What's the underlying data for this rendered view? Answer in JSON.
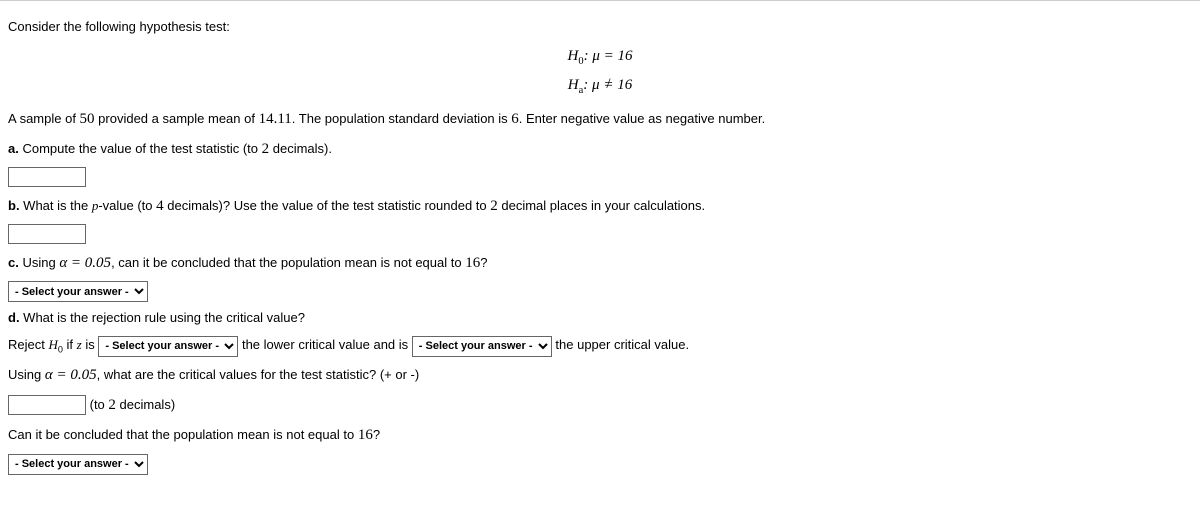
{
  "intro": "Consider the following hypothesis test:",
  "hyp_h0_lhs": "H",
  "hyp_h0_sub": "0",
  "hyp_h0_rest": ": μ = 16",
  "hyp_ha_lhs": "H",
  "hyp_ha_sub": "a",
  "hyp_ha_rest_pre": ": μ ",
  "hyp_ha_rest_post": " 16",
  "neq": "=",
  "sample_pre": "A sample of ",
  "sample_n": "50",
  "sample_mid1": " provided a sample mean of ",
  "sample_mean": "14.11",
  "sample_mid2": ". The population standard deviation is ",
  "sample_sigma": "6",
  "sample_end": ". Enter negative value as negative number.",
  "a_label": "a.",
  "a_text_pre": " Compute the value of the test statistic (to ",
  "a_text_dec": "2",
  "a_text_post": " decimals).",
  "b_label": "b.",
  "b_text_pre": " What is the ",
  "b_pvalue": "p",
  "b_text_mid": "-value (to ",
  "b_dec": "4",
  "b_text_mid2": " decimals)? Use the value of the test statistic rounded to ",
  "b_dec2": "2",
  "b_text_post": " decimal places in your calculations.",
  "c_label": "c.",
  "c_text_pre": " Using ",
  "c_alpha": "α = 0.05",
  "c_text_mid": ", can it be concluded that the population mean is not equal to ",
  "c_num": "16",
  "c_text_post": "?",
  "d_label": "d.",
  "d_text": "  What is the rejection rule using the critical value?",
  "d_reject_pre": "Reject ",
  "d_h0_h": "H",
  "d_h0_sub": "0",
  "d_if": " if ",
  "d_z": "z",
  "d_is": " is ",
  "d_mid": " the lower critical value and is ",
  "d_end": " the upper critical value.",
  "crit_pre": "Using ",
  "crit_alpha": "α = 0.05",
  "crit_mid": ", what are the critical values for the test statistic? (+ or -)",
  "crit_dec_pre": " (to ",
  "crit_dec": "2",
  "crit_dec_post": " decimals)",
  "final_pre": "Can it be concluded that the population mean is not equal to ",
  "final_num": "16",
  "final_post": "?",
  "select_placeholder": "- Select your answer -"
}
